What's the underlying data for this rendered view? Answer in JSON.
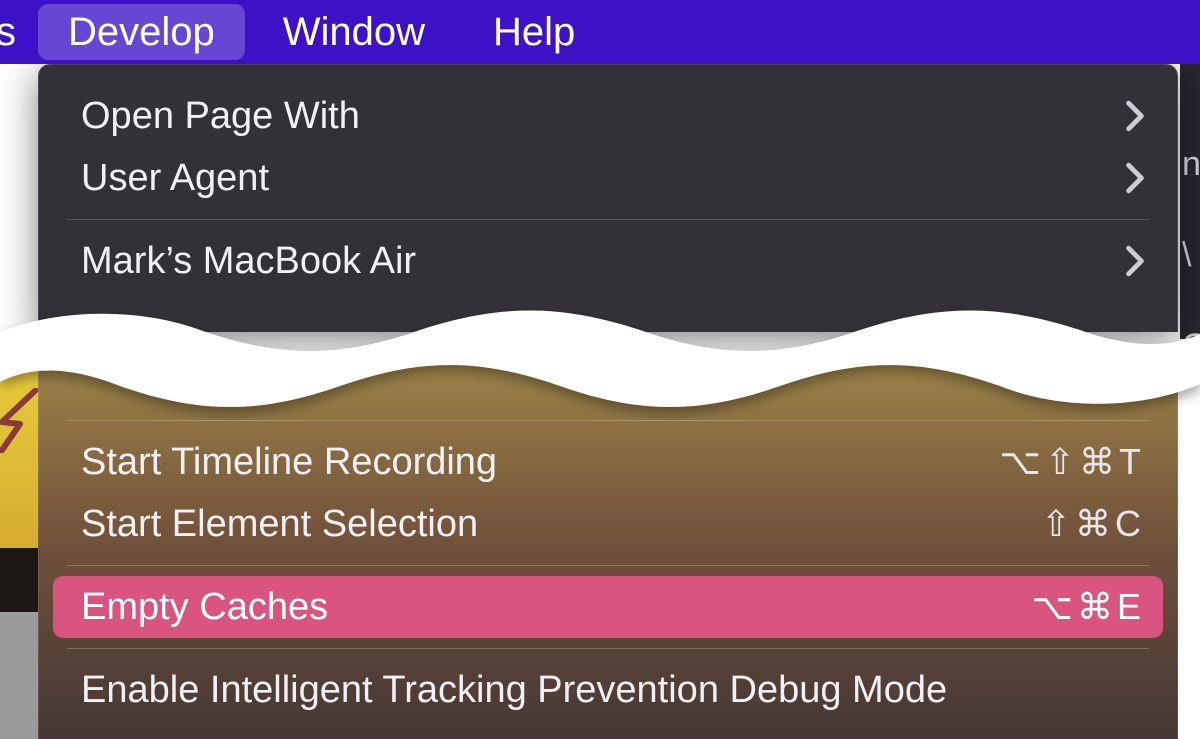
{
  "menubar": {
    "prev_fragment": "s",
    "items": [
      {
        "label": "Develop",
        "active": true
      },
      {
        "label": "Window",
        "active": false
      },
      {
        "label": "Help",
        "active": false
      }
    ]
  },
  "dropdown_top": {
    "items": [
      {
        "label": "Open Page With",
        "submenu": true
      },
      {
        "label": "User Agent",
        "submenu": true
      }
    ],
    "after_sep": [
      {
        "label": "Mark’s MacBook Air",
        "submenu": true
      }
    ]
  },
  "dropdown_bottom": {
    "group1": [
      {
        "label": "Start Timeline Recording",
        "shortcut": "⌥⇧⌘T"
      },
      {
        "label": "Start Element Selection",
        "shortcut": "⇧⌘C"
      }
    ],
    "highlighted": {
      "label": "Empty Caches",
      "shortcut": "⌥⌘E"
    },
    "group2": [
      {
        "label": "Enable Intelligent Tracking Prevention Debug Mode"
      }
    ]
  },
  "background_fragments": {
    "right_sliver_chars": [
      "n",
      "\\",
      "G"
    ]
  }
}
